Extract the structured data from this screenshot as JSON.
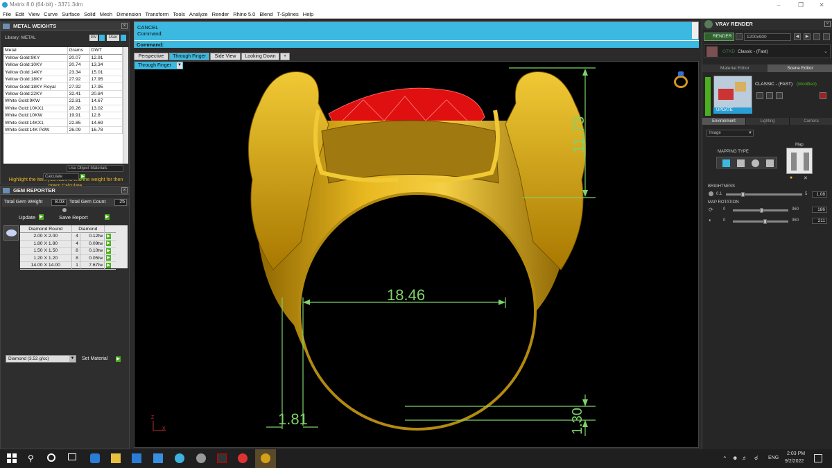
{
  "window": {
    "title": "Matrix 8.0 (64-bit) - 3371.3dm"
  },
  "menu": [
    "File",
    "Edit",
    "View",
    "Curve",
    "Surface",
    "Solid",
    "Mesh",
    "Dimension",
    "Transform",
    "Tools",
    "Analyze",
    "Render",
    "Rhino 5.0",
    "Blend",
    "T-Splines",
    "Help"
  ],
  "metal_weights": {
    "title": "METAL WEIGHTS",
    "library_label": "Library: METAL",
    "gv_label": "GV",
    "user_label": "User",
    "columns": [
      "Metal",
      "Grams",
      "DWT"
    ],
    "rows": [
      [
        "Yellow Gold:9KY",
        "20.07",
        "12.91"
      ],
      [
        "Yellow Gold:10KY",
        "20.74",
        "13.34"
      ],
      [
        "Yellow Gold:14KY",
        "23.34",
        "15.01"
      ],
      [
        "Yellow Gold:18KY",
        "27.92",
        "17.95"
      ],
      [
        "Yellow Gold:18KY Royal",
        "27.92",
        "17.95"
      ],
      [
        "Yellow Gold:22KY",
        "32.41",
        "20.84"
      ],
      [
        "White Gold:9KW",
        "22.81",
        "14.67"
      ],
      [
        "White Gold:10KX1",
        "20.26",
        "13.02"
      ],
      [
        "White Gold:10KW",
        "19.91",
        "12.8"
      ],
      [
        "White Gold:14KX1",
        "22.85",
        "14.69"
      ],
      [
        "White Gold:14K PdW",
        "26.09",
        "16.78"
      ]
    ],
    "use_object_materials": "Use Object Materials",
    "hint": "Highlight the item you want to find the weight for then press Calculate.",
    "calculate": "Calculate"
  },
  "gem_reporter": {
    "title": "GEM REPORTER",
    "total_weight_label": "Total Gem Weight",
    "total_weight": "8.03",
    "total_count_label": "Total Gem Count",
    "total_count": "25",
    "update": "Update",
    "save_report": "Save Report",
    "col1": "Diamond Round",
    "col2": "Diamond",
    "rows": [
      [
        "2.00 X 2.00",
        "4",
        "0.12tw"
      ],
      [
        "1.80 X 1.80",
        "4",
        "0.09tw"
      ],
      [
        "1.50 X 1.50",
        "8",
        "0.10tw"
      ],
      [
        "1.20 X 1.20",
        "8",
        "0.05tw"
      ],
      [
        "14.00 X 14.00",
        "1",
        "7.67tw"
      ]
    ],
    "material_select": "Diamond    (3.52 g/cc)",
    "set_material": "Set Material"
  },
  "command": {
    "line1": "CANCEL",
    "line2": "Command:",
    "prompt": "Command:"
  },
  "viewport": {
    "tabs": [
      "Perspective",
      "Through Finger",
      "Side View",
      "Looking Down",
      "+"
    ],
    "active_tab": 1,
    "view_label": "Through Finger",
    "dim_height": "11.73",
    "dim_width": "18.46",
    "dim_left": "1.81",
    "dim_bottom": "1.30",
    "axis_z": "Z",
    "axis_x": "X"
  },
  "vray": {
    "title": "VRAY RENDER",
    "render_btn": "RENDER",
    "resolution": "1200x900",
    "preset_prefix": "GTKD",
    "preset": "Classic - (Fast)",
    "tab_material": "Material Editor",
    "tab_scene": "Scene Editor",
    "scene_name": "CLASSIC - (FAST)",
    "scene_state": "(Modified)",
    "update": "UPDATE",
    "env_tabs": [
      "Environment",
      "Lighting",
      "Camera"
    ],
    "env_select": "Image",
    "mapping_type": "MAPPING TYPE",
    "map_label": "Map",
    "brightness_label": "BRIGHTNESS",
    "brightness_min": "0.1",
    "brightness_max": "5",
    "brightness_value": "1.08",
    "rotation_label": "MAP ROTATION",
    "rot_min": "0",
    "rot_max": "360",
    "rot1_value": "186",
    "rot2_value": "211"
  },
  "taskbar": {
    "lang": "ENG",
    "time": "2:03 PM",
    "date": "9/2/2022"
  },
  "colors": {
    "accent_blue": "#3bb9e0",
    "gold": "#d4a017",
    "ruby": "#e01010",
    "dim_green": "#7ed36a",
    "button_green": "#4caf20"
  }
}
